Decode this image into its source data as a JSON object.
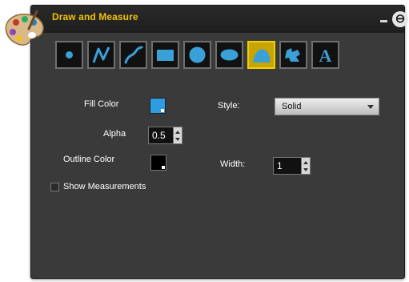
{
  "window": {
    "title": "Draw and Measure",
    "minimize_icon": "minimize-icon",
    "close_icon": "close-icon"
  },
  "toolbar": {
    "tools": [
      {
        "icon": "point-icon",
        "active": false
      },
      {
        "icon": "polyline-icon",
        "active": false
      },
      {
        "icon": "freehand-line-icon",
        "active": false
      },
      {
        "icon": "rectangle-icon",
        "active": false
      },
      {
        "icon": "circle-icon",
        "active": false
      },
      {
        "icon": "ellipse-icon",
        "active": false
      },
      {
        "icon": "freehand-polygon-icon",
        "active": true
      },
      {
        "icon": "polygon-icon",
        "active": false
      },
      {
        "icon": "text-icon",
        "active": false,
        "glyph": "A"
      }
    ]
  },
  "form": {
    "fill_color": {
      "label": "Fill Color",
      "color": "#2f9be0"
    },
    "style": {
      "label": "Style:",
      "selected": "Solid"
    },
    "alpha": {
      "label": "Alpha",
      "value": "0.5"
    },
    "outline_color": {
      "label": "Outline Color",
      "color": "#000000"
    },
    "width": {
      "label": "Width:",
      "value": "1"
    },
    "show_measurements": {
      "label": "Show Measurements",
      "checked": false
    }
  },
  "colors": {
    "accent": "#f2c200",
    "tool_icon": "#3aa0d8",
    "panel_bg": "#3a3a3a"
  }
}
